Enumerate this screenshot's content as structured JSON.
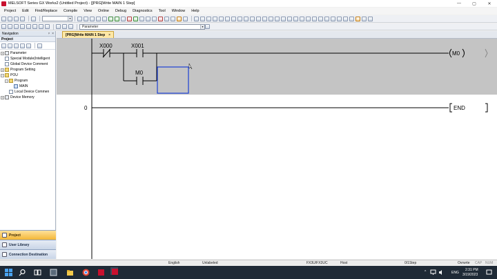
{
  "window": {
    "title": "MELSOFT Series GX Works2 (Untitled Project) - [[PRG]Write MAIN 1 Step]",
    "controls": [
      "—",
      "▢",
      "✕"
    ]
  },
  "menu": [
    "Project",
    "Edit",
    "Find/Replace",
    "Compile",
    "View",
    "Online",
    "Debug",
    "Diagnostics",
    "Tool",
    "Window",
    "Help"
  ],
  "toolbar": {
    "combo_parameter": "Parameter"
  },
  "navigation": {
    "header": "Navigation",
    "pin": "ᵖ",
    "close": "×",
    "section": "Project",
    "tree": [
      {
        "label": "Parameter",
        "level": 0,
        "expander": "+"
      },
      {
        "label": "Special Module(Intelligent",
        "level": 0,
        "expander": ""
      },
      {
        "label": "Global Device Comment",
        "level": 0,
        "expander": ""
      },
      {
        "label": "Program Setting",
        "level": 0,
        "expander": "+"
      },
      {
        "label": "POU",
        "level": 0,
        "expander": "−"
      },
      {
        "label": "Program",
        "level": 1,
        "expander": "−"
      },
      {
        "label": "MAIN",
        "level": 2,
        "expander": ""
      },
      {
        "label": "Local Device Commen",
        "level": 1,
        "expander": ""
      },
      {
        "label": "Device Memory",
        "level": 0,
        "expander": "+"
      }
    ],
    "tabs": [
      {
        "label": "Project",
        "active": true
      },
      {
        "label": "User Library",
        "active": false
      },
      {
        "label": "Connection Destination",
        "active": false
      }
    ]
  },
  "editor": {
    "tab_label": "[PRG]Write MAIN 1 Step",
    "tab_close": "×",
    "rung0": {
      "contact1": "X000",
      "contact2": "X001",
      "contact3": "M0",
      "coil": "M0"
    },
    "rung1": {
      "step": "0",
      "instruction": "END"
    }
  },
  "status": {
    "language": "English",
    "label": "Unlabeled",
    "cpu": "FX3U/FX3UC",
    "station": "Host",
    "steps": "0/1Step",
    "mode": "Ovrwrte",
    "caps": "CAP",
    "num": "NUM"
  },
  "taskbar": {
    "lang": "ENG",
    "time": "2:31 PM",
    "date": "3/19/2023",
    "tray_arrow": "^"
  }
}
